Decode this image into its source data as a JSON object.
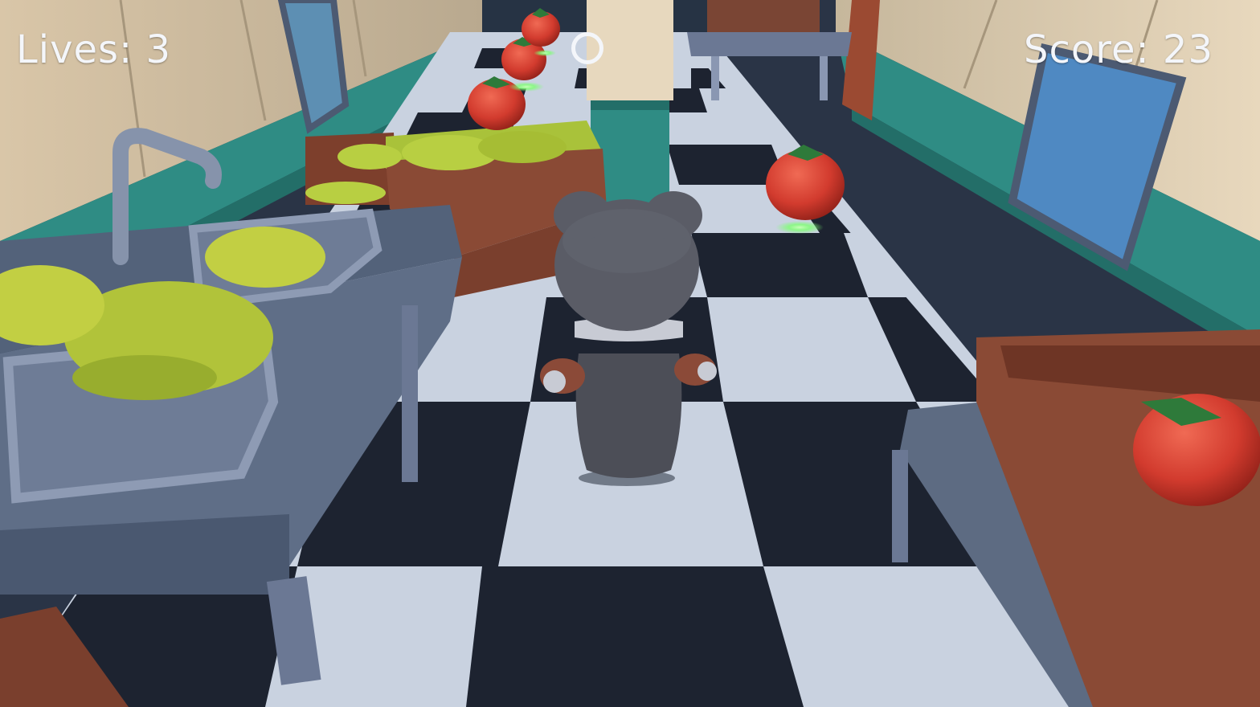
{
  "hud": {
    "lives_label": "Lives: 3",
    "lives_value": 3,
    "score_label": "Score: 23",
    "score_value": 23,
    "pause_icon": "circle-ring-icon"
  },
  "scene": {
    "setting": "train dining car kitchen aisle",
    "collectibles": [
      {
        "name": "tomato",
        "count_visible": 5
      }
    ],
    "obstacles": [
      "sink with lettuce",
      "lettuce crates",
      "tomato crate",
      "counter table",
      "standing chef legs"
    ],
    "player": "grey cat character seen from behind"
  },
  "colors": {
    "wall_panel": "#e6d2b6",
    "wall_teal": "#2f8c84",
    "floor_dark": "#1d2330",
    "floor_light": "#c9d2e0",
    "counter": "#5d6b82",
    "crate": "#8a4a35",
    "lettuce": "#a9c23a",
    "tomato": "#d23b2e",
    "glow": "#7dff72",
    "hud_text": "#f4f6fa"
  }
}
